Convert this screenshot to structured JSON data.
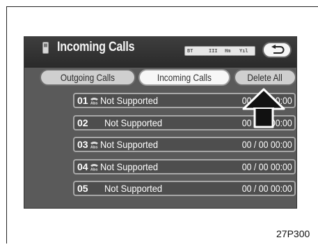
{
  "header": {
    "title": "Incoming Calls",
    "status": {
      "bt": "BT",
      "bars": "III",
      "hm": "Hm",
      "signal": "Yıl"
    },
    "icons": {
      "phone": "phone-icon",
      "back": "return-arrow-icon"
    }
  },
  "tabs": [
    {
      "label": "Outgoing Calls",
      "active": false
    },
    {
      "label": "Incoming Calls",
      "active": true
    },
    {
      "label": "Delete All",
      "active": false
    }
  ],
  "calls": [
    {
      "num": "01",
      "abs_icon": true,
      "name": "Not Supported",
      "time": "00 / 00 00:00"
    },
    {
      "num": "02",
      "abs_icon": false,
      "name": "Not Supported",
      "time": "00 / 00 00:00"
    },
    {
      "num": "03",
      "abs_icon": true,
      "name": "Not Supported",
      "time": "00 / 00 00:00"
    },
    {
      "num": "04",
      "abs_icon": true,
      "name": "Not Supported",
      "time": "00 / 00 00:00"
    },
    {
      "num": "05",
      "abs_icon": false,
      "name": "Not Supported",
      "time": "00 / 00 00:00"
    }
  ],
  "caption": "27P300",
  "colors": {
    "screen": "#5a5a5a",
    "header": "#2e2e2e",
    "active_tab": "#f7f7f7",
    "tab": "#cfcfcf"
  }
}
